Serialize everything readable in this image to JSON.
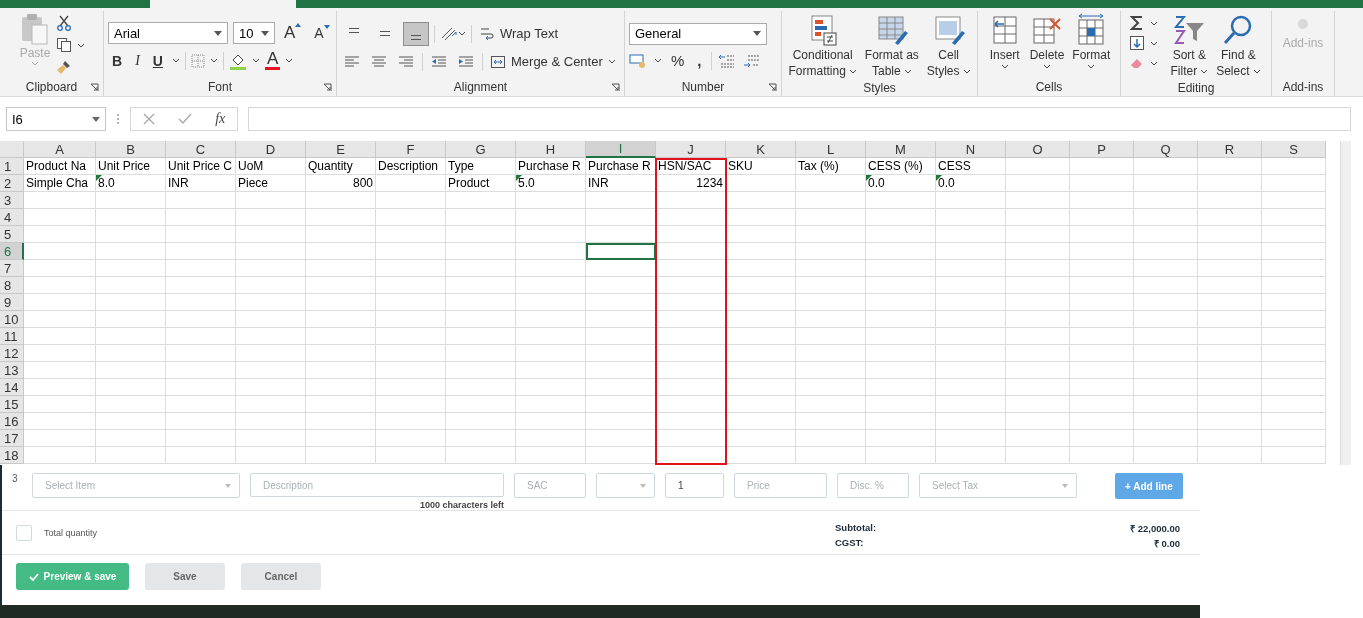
{
  "ribbon": {
    "clipboard": {
      "label": "Clipboard",
      "paste": "Paste"
    },
    "font": {
      "label": "Font",
      "family": "Arial",
      "size": "10",
      "grow": "A",
      "shrink": "A",
      "bold": "B",
      "italic": "I",
      "underline": "U",
      "font_color": "A"
    },
    "alignment": {
      "label": "Alignment",
      "vertical_align": [
        {
          "selected": false
        },
        {
          "selected": false
        },
        {
          "selected": true
        }
      ],
      "wrap_text": "Wrap Text",
      "merge": "Merge & Center"
    },
    "number": {
      "label": "Number",
      "format": "General",
      "percent": "%",
      "comma": ","
    },
    "styles": {
      "label": "Styles",
      "buttons": [
        {
          "kind": "conditional",
          "lines": [
            "Conditional",
            "Formatting"
          ]
        },
        {
          "kind": "table",
          "lines": [
            "Format as",
            "Table"
          ]
        },
        {
          "kind": "cell-styles",
          "lines": [
            "Cell",
            "Styles"
          ]
        }
      ]
    },
    "cells": {
      "label": "Cells",
      "buttons": [
        {
          "kind": "insert",
          "lines": [
            "Insert"
          ]
        },
        {
          "kind": "delete",
          "lines": [
            "Delete"
          ]
        },
        {
          "kind": "format",
          "lines": [
            "Format"
          ]
        }
      ]
    },
    "editing": {
      "label": "Editing",
      "buttons": [
        {
          "kind": "sort",
          "lines": [
            "Sort &",
            "Filter"
          ]
        },
        {
          "kind": "find",
          "lines": [
            "Find &",
            "Select"
          ]
        }
      ]
    },
    "addins": {
      "label": "Add-ins",
      "button": "Add-ins",
      "disabled": true
    }
  },
  "formula_bar": {
    "name_box": "I6",
    "fx": "fx"
  },
  "grid": {
    "columns": [
      {
        "label": "A",
        "selected": false,
        "framed": false
      },
      {
        "label": "B",
        "selected": false,
        "framed": false
      },
      {
        "label": "C",
        "selected": false,
        "framed": false
      },
      {
        "label": "D",
        "selected": false,
        "framed": false
      },
      {
        "label": "E",
        "selected": false,
        "framed": false
      },
      {
        "label": "F",
        "selected": false,
        "framed": false
      },
      {
        "label": "G",
        "selected": false,
        "framed": false
      },
      {
        "label": "H",
        "selected": false,
        "framed": false
      },
      {
        "label": "I",
        "selected": true,
        "framed": false
      },
      {
        "label": "J",
        "selected": false,
        "framed": true
      },
      {
        "label": "K",
        "selected": false,
        "framed": false
      },
      {
        "label": "L",
        "selected": false,
        "framed": false
      },
      {
        "label": "M",
        "selected": false,
        "framed": false
      },
      {
        "label": "N",
        "selected": false,
        "framed": false
      },
      {
        "label": "O",
        "selected": false,
        "framed": false
      },
      {
        "label": "P",
        "selected": false,
        "framed": false
      },
      {
        "label": "Q",
        "selected": false,
        "framed": false
      },
      {
        "label": "R",
        "selected": false,
        "framed": false
      },
      {
        "label": "S",
        "selected": false,
        "framed": false
      }
    ],
    "rows": [
      {
        "number": "1",
        "selected": false,
        "cells": [
          {
            "text": "Product Na",
            "kind": "text",
            "flagged": false
          },
          {
            "text": "Unit Price",
            "kind": "text",
            "flagged": false
          },
          {
            "text": "Unit Price C",
            "kind": "text",
            "flagged": false
          },
          {
            "text": "UoM",
            "kind": "text",
            "flagged": false
          },
          {
            "text": "Quantity",
            "kind": "text",
            "flagged": false
          },
          {
            "text": "Description",
            "kind": "text",
            "flagged": false
          },
          {
            "text": "Type",
            "kind": "text",
            "flagged": false
          },
          {
            "text": "Purchase R",
            "kind": "text",
            "flagged": false
          },
          {
            "text": "Purchase R",
            "kind": "text",
            "flagged": false
          },
          {
            "text": "HSN/SAC",
            "kind": "text",
            "flagged": false
          },
          {
            "text": "SKU",
            "kind": "text",
            "flagged": false
          },
          {
            "text": "Tax (%)",
            "kind": "text",
            "flagged": false
          },
          {
            "text": "CESS (%)",
            "kind": "text",
            "flagged": false
          },
          {
            "text": "CESS",
            "kind": "text",
            "flagged": false
          }
        ]
      },
      {
        "number": "2",
        "selected": false,
        "cells": [
          {
            "text": "Simple Cha",
            "kind": "text",
            "flagged": false
          },
          {
            "text": "8.0",
            "kind": "text",
            "flagged": true
          },
          {
            "text": "INR",
            "kind": "text",
            "flagged": false
          },
          {
            "text": "Piece",
            "kind": "text",
            "flagged": false
          },
          {
            "text": "800",
            "kind": "number",
            "flagged": false
          },
          null,
          {
            "text": "Product",
            "kind": "text",
            "flagged": false
          },
          {
            "text": "5.0",
            "kind": "text",
            "flagged": true
          },
          {
            "text": "INR",
            "kind": "text",
            "flagged": false
          },
          {
            "text": "1234",
            "kind": "number",
            "flagged": false
          },
          null,
          null,
          {
            "text": "0.0",
            "kind": "text",
            "flagged": true
          },
          {
            "text": "0.0",
            "kind": "text",
            "flagged": true
          }
        ]
      },
      {
        "number": "3",
        "selected": false
      },
      {
        "number": "4",
        "selected": false
      },
      {
        "number": "5",
        "selected": false
      },
      {
        "number": "6",
        "selected": true
      },
      {
        "number": "7",
        "selected": false
      },
      {
        "number": "8",
        "selected": false
      },
      {
        "number": "9",
        "selected": false
      },
      {
        "number": "10",
        "selected": false
      },
      {
        "number": "11",
        "selected": false
      },
      {
        "number": "12",
        "selected": false
      },
      {
        "number": "13",
        "selected": false
      },
      {
        "number": "14",
        "selected": false
      },
      {
        "number": "15",
        "selected": false
      },
      {
        "number": "16",
        "selected": false
      },
      {
        "number": "17",
        "selected": false
      },
      {
        "number": "18",
        "selected": false
      }
    ]
  },
  "form": {
    "row_number": "3",
    "fields": [
      {
        "kind": "select",
        "placeholder": "Select Item"
      },
      {
        "kind": "text",
        "placeholder": "Description"
      },
      {
        "kind": "text",
        "placeholder": "SAC"
      },
      {
        "kind": "select"
      },
      {
        "kind": "text",
        "value": "1"
      },
      {
        "kind": "text",
        "placeholder": "Price"
      },
      {
        "kind": "text",
        "placeholder": "Disc. %"
      },
      {
        "kind": "select",
        "placeholder": "Select Tax"
      }
    ],
    "add_button": "+ Add line",
    "chars_left": "1000 characters left",
    "total_quantity": {
      "label": "Total quantity",
      "checked": false
    },
    "summary": [
      {
        "label": "Subtotal:",
        "value": "₹ 22,000.00"
      },
      {
        "label": "CGST:",
        "value": "₹ 0.00"
      }
    ],
    "buttons": [
      {
        "kind": "primary",
        "label": "Preview & save"
      },
      {
        "kind": "secondary",
        "label": "Save"
      },
      {
        "kind": "secondary",
        "label": "Cancel"
      }
    ]
  }
}
